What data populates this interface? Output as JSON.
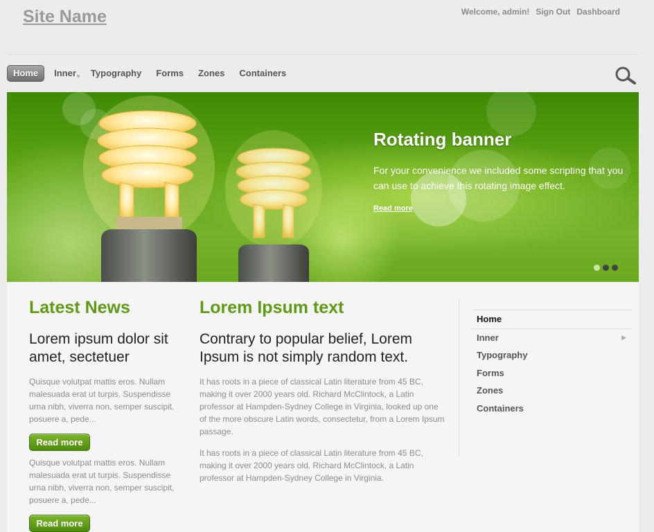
{
  "header": {
    "site_name": "Site Name",
    "welcome": "Welcome, admin!",
    "sign_out": "Sign Out",
    "dashboard": "Dashboard"
  },
  "nav": {
    "items": [
      "Home",
      "Inner",
      "Typography",
      "Forms",
      "Zones",
      "Containers"
    ],
    "active": "Home",
    "search_icon": "magnifier-icon"
  },
  "banner": {
    "title": "Rotating banner",
    "description": "For your convenience we included some scripting that you can use to achieve this rotating image effect.",
    "link": "Read more",
    "slide_count": 3,
    "active_slide": 1
  },
  "news": {
    "title": "Latest News",
    "headline": "Lorem ipsum dolor sit amet, sectetuer",
    "items": [
      {
        "text": "Quisque volutpat mattis eros. Nullam malesuada erat ut turpis. Suspendisse urna nibh, viverra non, semper suscipit, posuere a, pede...",
        "button": "Read more"
      },
      {
        "text": "Quisque volutpat mattis eros. Nullam malesuada erat ut turpis. Suspendisse urna nibh, viverra non, semper suscipit, posuere a, pede...",
        "button": "Read more"
      }
    ]
  },
  "lorem": {
    "title": "Lorem Ipsum text",
    "headline": "Contrary to popular belief, Lorem Ipsum is not simply random text.",
    "p1": "It has roots in a piece of classical Latin literature from 45 BC, making it over 2000 years old. Richard McClintock, a Latin professor at Hampden-Sydney College in Virginia, looked up one of the more obscure Latin words, consectetur, from a Lorem Ipsum passage.",
    "p2": "It has roots in a piece of classical Latin literature from 45 BC, making it over 2000 years old. Richard McClintock, a Latin professor at Hampden-Sydney College in Virginia."
  },
  "sidebar": {
    "items": [
      "Home",
      "Inner",
      "Typography",
      "Forms",
      "Zones",
      "Containers"
    ]
  },
  "colors": {
    "accent_green": "#5f9a16",
    "button_green": "#5d9a14",
    "background": "#ececec"
  }
}
